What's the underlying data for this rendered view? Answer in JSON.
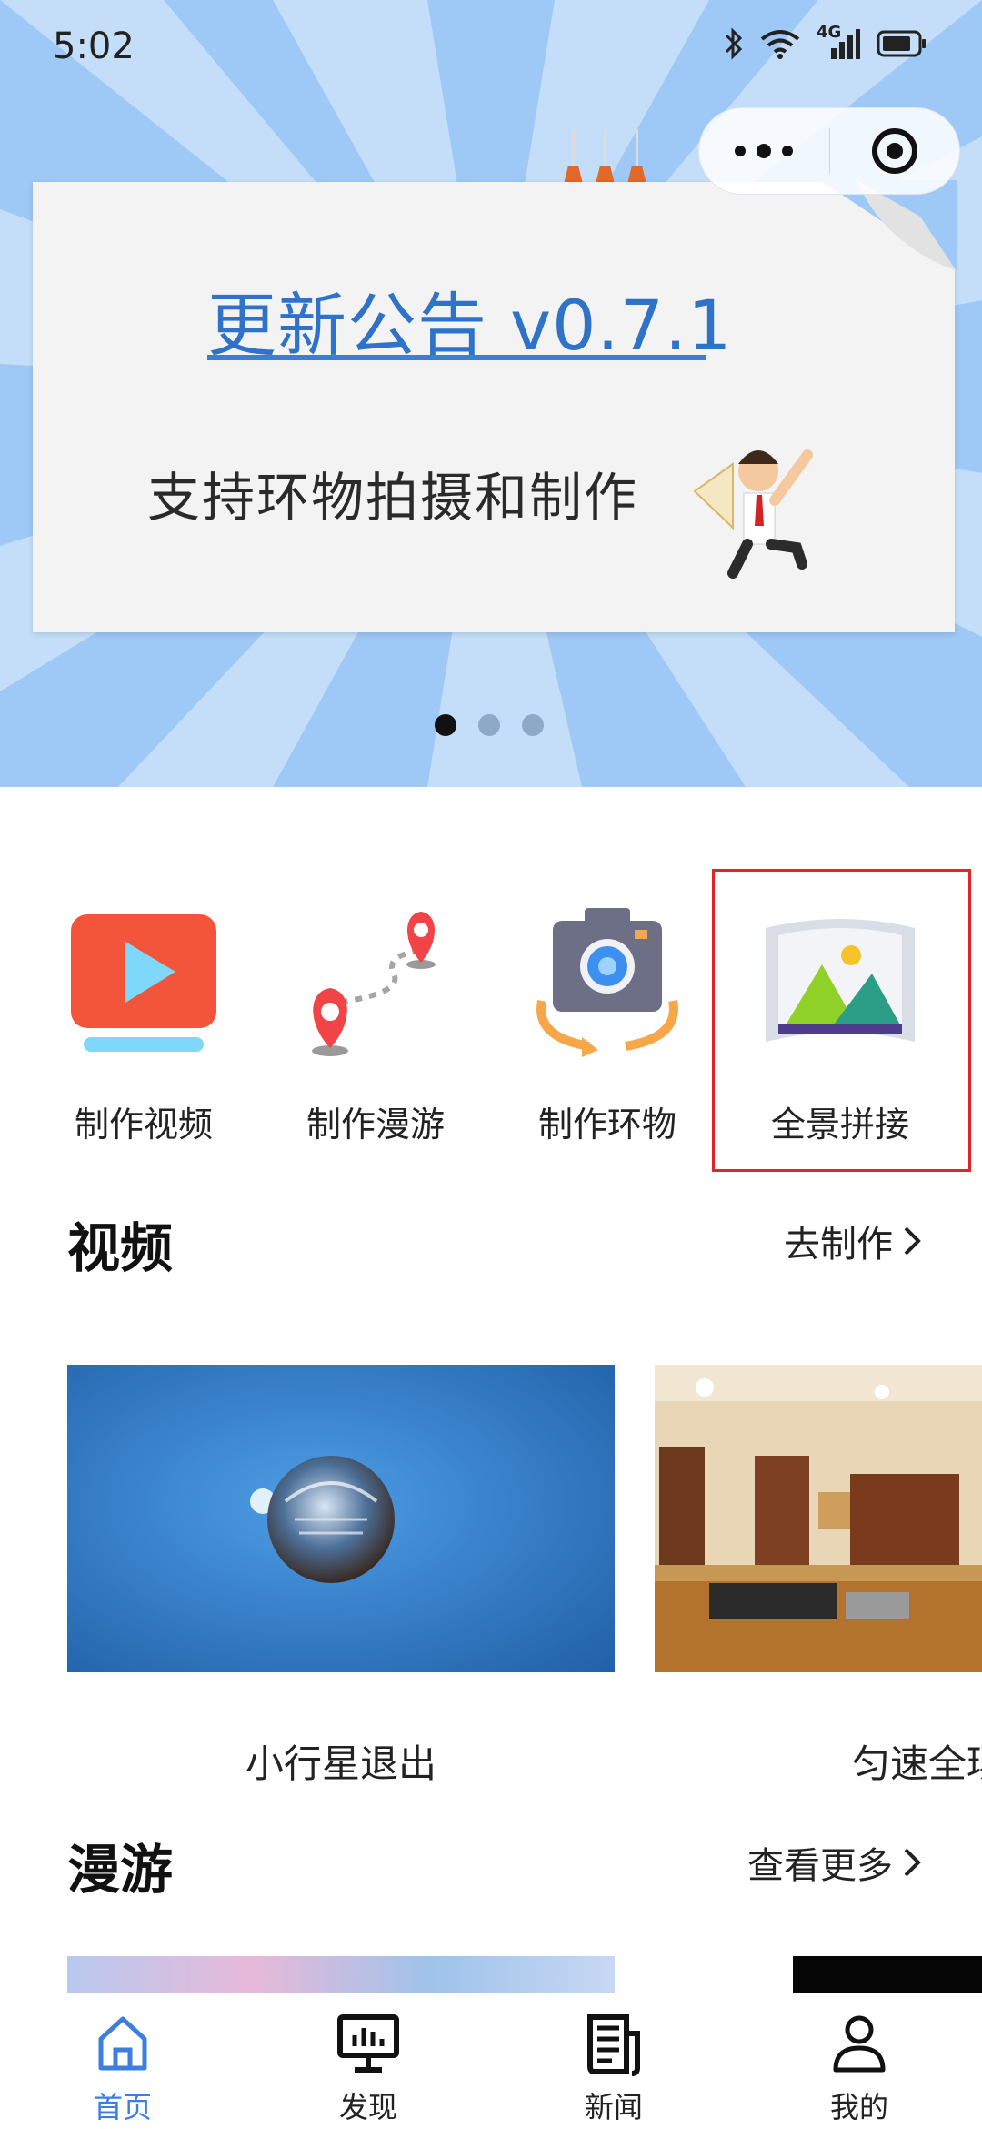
{
  "status_bar": {
    "time": "5:02",
    "network": "4G"
  },
  "capsule": {
    "more_icon": "more-dots-icon",
    "close_icon": "target-circle-icon"
  },
  "banner": {
    "title": "更新公告 v0.7.1",
    "subtitle": "支持环物拍摄和制作",
    "indicator_count": 3,
    "active_indicator": 0,
    "colors": {
      "title": "#2f73c9",
      "background": "#9ec8f5"
    }
  },
  "entries": [
    {
      "label": "制作视频",
      "icon": "video-play-icon"
    },
    {
      "label": "制作漫游",
      "icon": "map-route-pin-icon"
    },
    {
      "label": "制作环物",
      "icon": "camera-rotate-icon"
    },
    {
      "label": "全景拼接",
      "icon": "panorama-mountain-icon"
    }
  ],
  "video_section": {
    "title": "视频",
    "more": "去制作",
    "items": [
      {
        "caption": "小行星退出"
      },
      {
        "caption": "匀速全玚"
      }
    ]
  },
  "tour_section": {
    "title": "漫游",
    "more": "查看更多"
  },
  "tabbar": {
    "active_color": "#3d7ee0",
    "items": [
      {
        "label": "首页",
        "icon": "home-icon",
        "active": true
      },
      {
        "label": "发现",
        "icon": "monitor-chart-icon",
        "active": false
      },
      {
        "label": "新闻",
        "icon": "news-document-icon",
        "active": false
      },
      {
        "label": "我的",
        "icon": "user-profile-icon",
        "active": false
      }
    ]
  }
}
